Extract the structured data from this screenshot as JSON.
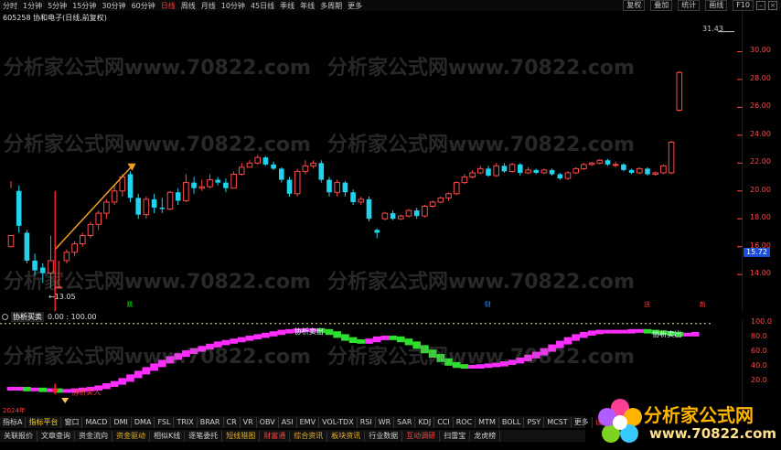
{
  "toolbar": {
    "periods": [
      {
        "label": "分时",
        "active": false
      },
      {
        "label": "1分钟",
        "active": false
      },
      {
        "label": "5分钟",
        "active": false
      },
      {
        "label": "15分钟",
        "active": false
      },
      {
        "label": "30分钟",
        "active": false
      },
      {
        "label": "60分钟",
        "active": false
      },
      {
        "label": "日线",
        "active": true
      },
      {
        "label": "周线",
        "active": false
      },
      {
        "label": "月线",
        "active": false
      },
      {
        "label": "10分钟",
        "active": false
      },
      {
        "label": "45日线",
        "active": false
      },
      {
        "label": "季线",
        "active": false
      },
      {
        "label": "年线",
        "active": false
      },
      {
        "label": "多周期",
        "active": false
      },
      {
        "label": "更多",
        "active": false
      }
    ],
    "right_buttons": [
      "复权",
      "叠加",
      "统计",
      "画线",
      "F10"
    ]
  },
  "stock": {
    "title": "605258 协和电子(日线,前复权)"
  },
  "chart_data": {
    "type": "candlestick",
    "y_ticks": [
      "30.00",
      "28.00",
      "26.00",
      "24.00",
      "22.00",
      "20.00",
      "18.00",
      "16.00",
      "14.00"
    ],
    "ylim": [
      12.5,
      31.8
    ],
    "last_price_label": "31.43",
    "low_label": "←13.05",
    "price_tag": "15.72",
    "candles": [
      [
        16.0,
        16.8,
        20.2,
        20.7
      ],
      [
        20.0,
        17.5,
        20.4,
        17.0
      ],
      [
        17.0,
        15.0,
        17.2,
        14.8
      ],
      [
        15.0,
        14.3,
        15.5,
        13.9
      ],
      [
        14.5,
        14.1,
        14.8,
        13.4
      ],
      [
        14.1,
        15.0,
        16.8,
        13.0
      ],
      [
        13.1,
        13.1,
        15.0,
        13.05
      ],
      [
        15.0,
        15.6,
        15.8,
        14.8
      ],
      [
        15.6,
        16.2,
        16.4,
        15.3
      ],
      [
        16.2,
        16.8,
        17.0,
        16.0
      ],
      [
        16.8,
        17.6,
        17.8,
        16.6
      ],
      [
        17.6,
        18.4,
        18.6,
        17.2
      ],
      [
        18.4,
        19.2,
        19.4,
        18.0
      ],
      [
        19.2,
        20.0,
        20.4,
        19.0
      ],
      [
        20.0,
        21.0,
        21.2,
        19.6
      ],
      [
        21.2,
        19.5,
        21.4,
        19.2
      ],
      [
        19.5,
        18.3,
        19.8,
        18.0
      ],
      [
        18.3,
        19.4,
        19.6,
        18.0
      ],
      [
        19.4,
        18.8,
        19.8,
        18.4
      ],
      [
        18.8,
        18.7,
        19.5,
        18.4
      ],
      [
        18.7,
        19.9,
        20.0,
        18.6
      ],
      [
        19.9,
        19.3,
        20.2,
        19.0
      ],
      [
        19.3,
        20.6,
        21.2,
        19.2
      ],
      [
        20.6,
        20.2,
        21.0,
        19.8
      ],
      [
        20.2,
        20.3,
        20.8,
        20.0
      ],
      [
        20.3,
        20.8,
        21.2,
        20.2
      ],
      [
        20.8,
        20.6,
        21.0,
        20.4
      ],
      [
        20.6,
        20.2,
        20.9,
        19.9
      ],
      [
        20.2,
        21.2,
        21.4,
        20.2
      ],
      [
        21.2,
        21.7,
        22.0,
        21.1
      ],
      [
        21.7,
        22.0,
        22.2,
        21.7
      ],
      [
        22.0,
        22.4,
        22.6,
        21.9
      ],
      [
        22.4,
        21.9,
        22.5,
        21.8
      ],
      [
        21.9,
        21.6,
        22.1,
        21.5
      ],
      [
        21.6,
        20.8,
        21.7,
        20.6
      ],
      [
        20.8,
        19.8,
        21.0,
        19.6
      ],
      [
        19.8,
        21.4,
        21.6,
        19.6
      ],
      [
        21.4,
        21.8,
        22.2,
        21.2
      ],
      [
        21.8,
        22.0,
        22.2,
        21.6
      ],
      [
        22.0,
        20.8,
        22.2,
        20.6
      ],
      [
        20.8,
        19.9,
        21.0,
        19.6
      ],
      [
        19.9,
        20.6,
        20.8,
        19.6
      ],
      [
        20.6,
        19.9,
        20.7,
        19.6
      ],
      [
        19.9,
        19.2,
        20.1,
        19.0
      ],
      [
        19.2,
        19.4,
        19.6,
        19.0
      ],
      [
        19.4,
        18.0,
        19.6,
        17.8
      ],
      [
        17.2,
        17.0,
        17.3,
        16.6
      ],
      [
        18.0,
        18.4,
        18.5,
        17.9
      ],
      [
        18.4,
        18.0,
        18.6,
        17.9
      ],
      [
        18.0,
        18.2,
        18.3,
        17.9
      ],
      [
        18.2,
        18.6,
        18.7,
        18.1
      ],
      [
        18.6,
        18.2,
        18.8,
        18.0
      ],
      [
        18.2,
        18.9,
        19.0,
        18.1
      ],
      [
        18.9,
        19.2,
        19.3,
        18.8
      ],
      [
        19.2,
        19.5,
        19.6,
        19.1
      ],
      [
        19.5,
        19.8,
        19.9,
        19.3
      ],
      [
        19.8,
        20.6,
        20.7,
        19.7
      ],
      [
        20.6,
        21.0,
        21.2,
        20.5
      ],
      [
        21.0,
        21.3,
        21.5,
        20.9
      ],
      [
        21.3,
        21.6,
        21.8,
        21.2
      ],
      [
        21.6,
        21.1,
        21.8,
        21.0
      ],
      [
        21.1,
        21.8,
        22.0,
        21.0
      ],
      [
        21.8,
        21.4,
        22.0,
        21.3
      ],
      [
        21.4,
        21.9,
        22.0,
        21.3
      ],
      [
        21.9,
        21.3,
        22.0,
        21.1
      ],
      [
        21.3,
        21.5,
        21.7,
        21.2
      ],
      [
        21.5,
        21.3,
        21.6,
        21.2
      ],
      [
        21.3,
        21.5,
        21.6,
        21.2
      ],
      [
        21.5,
        21.2,
        21.6,
        21.1
      ],
      [
        21.2,
        20.9,
        21.3,
        20.8
      ],
      [
        20.9,
        21.3,
        21.4,
        20.8
      ],
      [
        21.3,
        21.6,
        21.7,
        21.2
      ],
      [
        21.6,
        21.9,
        22.0,
        21.5
      ],
      [
        21.9,
        22.0,
        22.1,
        21.8
      ],
      [
        22.0,
        22.2,
        22.3,
        21.9
      ],
      [
        22.2,
        21.9,
        22.3,
        21.8
      ],
      [
        21.9,
        21.9,
        22.1,
        21.7
      ],
      [
        21.9,
        21.5,
        22.0,
        21.4
      ],
      [
        21.5,
        21.3,
        21.6,
        21.2
      ],
      [
        21.3,
        21.6,
        21.7,
        21.2
      ],
      [
        21.6,
        21.2,
        21.7,
        21.1
      ],
      [
        21.2,
        21.3,
        21.4,
        21.1
      ],
      [
        21.3,
        21.8,
        21.9,
        21.2
      ],
      [
        21.3,
        23.5,
        23.6,
        21.2
      ],
      [
        25.8,
        28.5,
        28.6,
        25.7
      ]
    ],
    "markers": [
      {
        "label": "跳",
        "index": 15,
        "color": "#00e000"
      },
      {
        "label": "财",
        "index": 60,
        "color": "#2a8cff"
      },
      {
        "label": "送",
        "index": 80,
        "color": "#ff3030"
      },
      {
        "label": "新",
        "index": 87,
        "color": "#ff3030"
      }
    ]
  },
  "indicator": {
    "name": "协析买卖",
    "params": "0.00 : 100.00",
    "y_ticks": [
      "100.0",
      "80.0",
      "60.0",
      "40.0",
      "20.0"
    ],
    "ylim": [
      0,
      100
    ],
    "ref_line": 99,
    "values": [
      10,
      10,
      9,
      9,
      8,
      8,
      7,
      7,
      8,
      9,
      10,
      12,
      15,
      18,
      22,
      27,
      32,
      37,
      42,
      47,
      52,
      56,
      60,
      63,
      66,
      69,
      72,
      74,
      76,
      78,
      80,
      82,
      84,
      86,
      88,
      89,
      90,
      90,
      90,
      89,
      86,
      82,
      78,
      75,
      74,
      76,
      79,
      80,
      79,
      76,
      72,
      67,
      61,
      55,
      49,
      44,
      41,
      40,
      40,
      41,
      42,
      43,
      45,
      47,
      50,
      54,
      58,
      63,
      68,
      73,
      78,
      82,
      85,
      87,
      88,
      88,
      88,
      88,
      89,
      89,
      88,
      87,
      86,
      85,
      84,
      84,
      85
    ],
    "buy_index": 6,
    "buy_label": "协析买入",
    "sell_labels": [
      {
        "index": 37,
        "text": "协析卖出"
      },
      {
        "index": 82,
        "text": "协析卖出"
      }
    ],
    "up_color": "#ff2dff",
    "down_color": "#2ee02e"
  },
  "date_label": "2024年",
  "indicator_tabs": [
    {
      "label": "指标A",
      "style": ""
    },
    {
      "label": "指标平台",
      "style": "highlight"
    },
    {
      "label": "窗口",
      "style": ""
    },
    {
      "label": "MACD",
      "style": ""
    },
    {
      "label": "DMI",
      "style": ""
    },
    {
      "label": "DMA",
      "style": ""
    },
    {
      "label": "FSL",
      "style": ""
    },
    {
      "label": "TRIX",
      "style": ""
    },
    {
      "label": "BRAR",
      "style": ""
    },
    {
      "label": "CR",
      "style": ""
    },
    {
      "label": "VR",
      "style": ""
    },
    {
      "label": "OBV",
      "style": ""
    },
    {
      "label": "ASI",
      "style": ""
    },
    {
      "label": "EMV",
      "style": ""
    },
    {
      "label": "VOL-TDX",
      "style": ""
    },
    {
      "label": "RSI",
      "style": ""
    },
    {
      "label": "WR",
      "style": ""
    },
    {
      "label": "SAR",
      "style": ""
    },
    {
      "label": "KDJ",
      "style": ""
    },
    {
      "label": "CCI",
      "style": ""
    },
    {
      "label": "ROC",
      "style": ""
    },
    {
      "label": "MTM",
      "style": ""
    },
    {
      "label": "BOLL",
      "style": ""
    },
    {
      "label": "PSY",
      "style": ""
    },
    {
      "label": "MCST",
      "style": ""
    },
    {
      "label": "更多",
      "style": ""
    },
    {
      "label": "设置",
      "style": "red"
    }
  ],
  "function_bar": [
    {
      "label": "关联报价",
      "style": ""
    },
    {
      "label": "文章查询",
      "style": ""
    },
    {
      "label": "资金流向",
      "style": ""
    },
    {
      "label": "资金驱动",
      "style": "gold"
    },
    {
      "label": "相似K线",
      "style": ""
    },
    {
      "label": "逐笔委托",
      "style": ""
    },
    {
      "label": "短线猎图",
      "style": "gold"
    },
    {
      "label": "财富通",
      "style": "red"
    },
    {
      "label": "综合资讯",
      "style": "gold"
    },
    {
      "label": "板块资讯",
      "style": "gold"
    },
    {
      "label": "行业数据",
      "style": ""
    },
    {
      "label": "互动调研",
      "style": "red"
    },
    {
      "label": "扫雷宝",
      "style": ""
    },
    {
      "label": "龙虎榜",
      "style": ""
    }
  ],
  "watermarks": [
    "分析家公式网www.70822.com",
    "分析家公式网www.70822.com",
    "分析家公式网www.70822.com",
    "分析家公式网www.70822.com",
    "分析家公式网www.70822.com",
    "分析家公式网www.70822.com",
    "分析家公式网www.70822.com",
    "分析家公式网www.70822.com"
  ],
  "brand": {
    "name": "分析家公式网",
    "url": "www.70822.com"
  },
  "colors": {
    "up": "#ff4a4a",
    "down": "#22d3ee",
    "axis": "#ff4a4a",
    "arrow_up": "#f0a020",
    "arrow_down": "#ff2020"
  }
}
